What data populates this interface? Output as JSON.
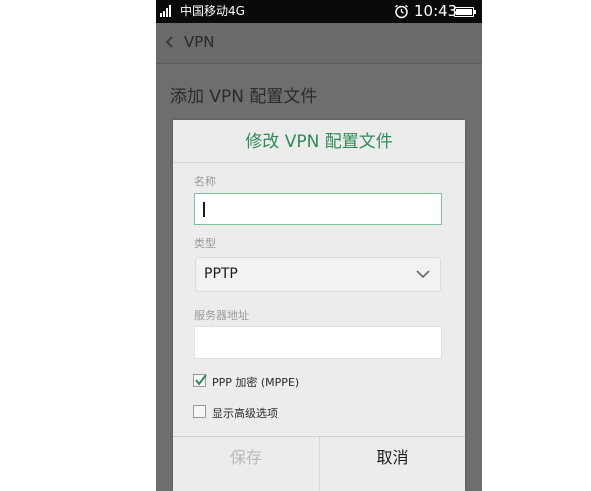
{
  "status_bar": {
    "carrier": "中国移动4G",
    "time": "10:43"
  },
  "action_bar": {
    "title": "VPN"
  },
  "background": {
    "heading": "添加 VPN 配置文件"
  },
  "dialog": {
    "title": "修改 VPN 配置文件",
    "name_label": "名称",
    "name_value": "",
    "type_label": "类型",
    "type_value": "PPTP",
    "server_label": "服务器地址",
    "server_value": "",
    "mppe_label": "PPP 加密 (MPPE)",
    "mppe_checked": true,
    "advanced_label": "显示高级选项",
    "advanced_checked": false,
    "save_label": "保存",
    "cancel_label": "取消"
  },
  "colors": {
    "accent": "#2e8b57",
    "dim_overlay": "#6e6e6e",
    "disabled_text": "#b9b9b9"
  },
  "icons": {
    "signal": "signal-icon",
    "alarm": "alarm-icon",
    "battery": "battery-icon",
    "back": "chevron-left-icon",
    "dropdown": "chevron-down-icon",
    "check": "check-icon"
  }
}
